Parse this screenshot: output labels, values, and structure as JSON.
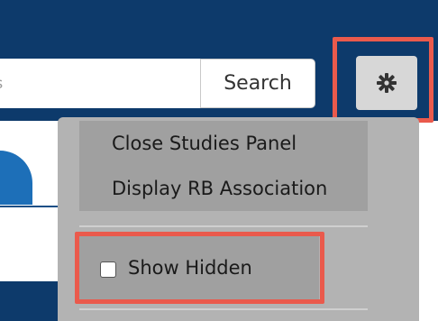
{
  "search": {
    "partial_text": "as",
    "button_label": "Search"
  },
  "settings_menu": {
    "items": [
      {
        "label": "Close Studies Panel"
      },
      {
        "label": "Display RB Association"
      }
    ],
    "show_hidden_label": "Show Hidden",
    "show_hidden_checked": false
  },
  "icons": {
    "gear": "gear-icon"
  },
  "colors": {
    "header_bg": "#0d3a6b",
    "highlight": "#ea5a4c",
    "tab_blue": "#1d6fb8"
  }
}
